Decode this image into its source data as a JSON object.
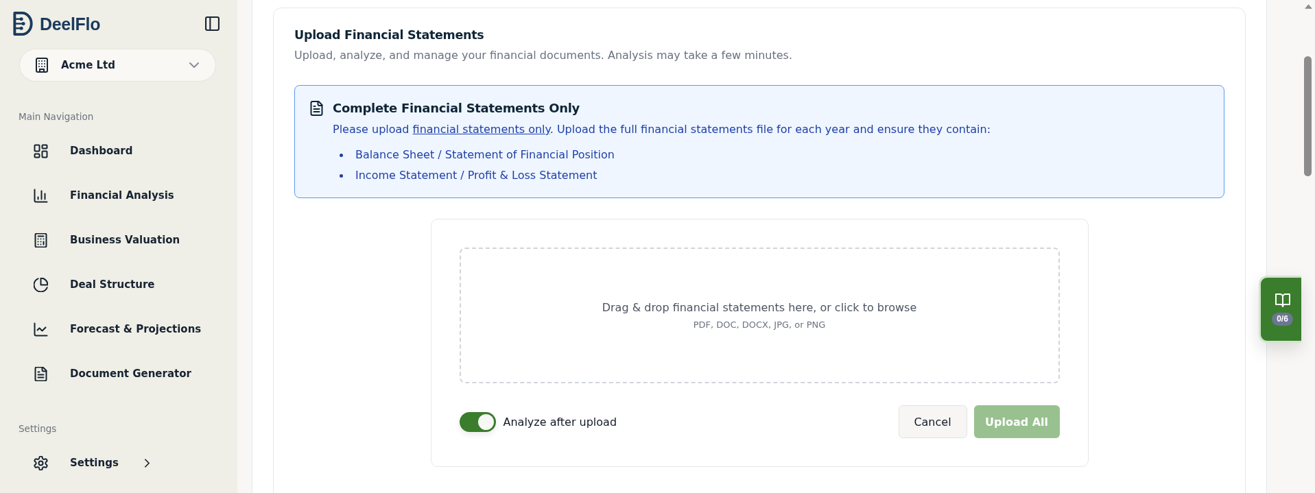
{
  "sidebar": {
    "brand": "DeelFlo",
    "company": "Acme Ltd",
    "sections": [
      {
        "heading": "Main Navigation",
        "items": [
          {
            "label": "Dashboard",
            "selected": false
          },
          {
            "label": "Financial Analysis",
            "selected": false
          },
          {
            "label": "Business Valuation",
            "selected": false
          },
          {
            "label": "Deal Structure",
            "selected": false
          },
          {
            "label": "Forecast & Projections",
            "selected": false
          },
          {
            "label": "Document Generator",
            "selected": false
          }
        ]
      },
      {
        "heading": "Settings",
        "items": [
          {
            "label": "Settings",
            "selected": false,
            "expanded": false
          }
        ]
      }
    ]
  },
  "upload": {
    "title": "Upload Financial Statements",
    "subtitle": "Upload, analyze, and manage your financial documents. Analysis may take a few minutes.",
    "notice": {
      "title": "Complete Financial Statements Only",
      "text_before": "Please upload ",
      "link": "financial statements only",
      "text_after": ". Upload the full financial statements file for each year and ensure they contain:",
      "items": [
        "Balance Sheet / Statement of Financial Position",
        "Income Statement / Profit & Loss Statement"
      ]
    },
    "dropzone": {
      "text": "Drag & drop financial statements here, or click to browse",
      "hint": "PDF, DOC, DOCX, JPG, or PNG"
    },
    "analyze_toggle": {
      "label": "Analyze after upload",
      "on": true
    },
    "buttons": [
      {
        "label": "Cancel",
        "kind": "secondary",
        "disabled": false
      },
      {
        "label": "Upload All",
        "kind": "primary",
        "disabled": true
      }
    ]
  },
  "guide_tab": {
    "badge": "0/6"
  }
}
